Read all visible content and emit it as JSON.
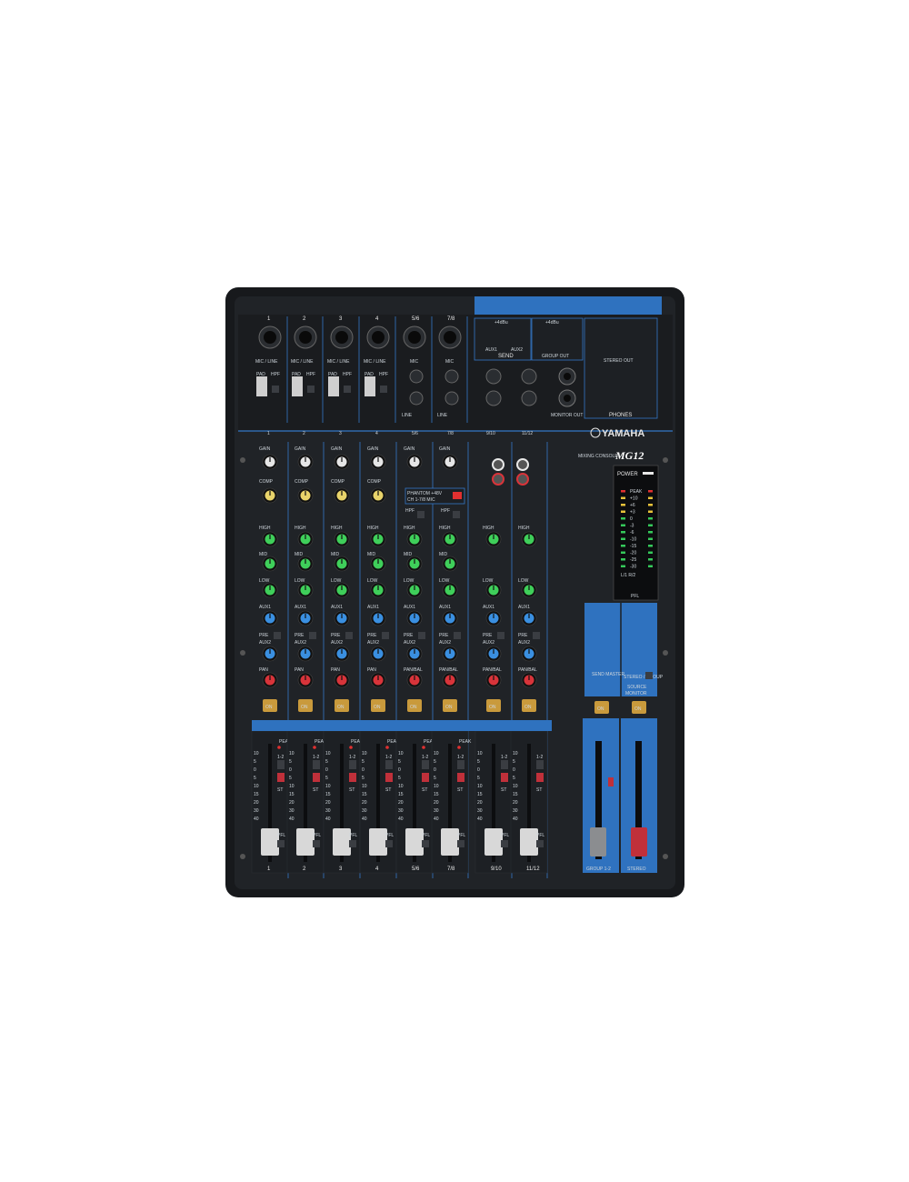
{
  "brand": "YAMAHA",
  "model_caption": "MIXING CONSOLE",
  "model": "MG12",
  "power_label": "POWER",
  "channels": [
    "1",
    "2",
    "3",
    "4",
    "5/6",
    "7/8",
    "9/10",
    "11/12"
  ],
  "mic_line_label": "MIC / LINE",
  "mic_label": "MIC",
  "pad_label": "PAD",
  "hpf_label": "HPF",
  "hpf_freq": "80Hz",
  "line_label": "LINE",
  "unbal_label": "UNBAL",
  "mono_label": "L/MONO",
  "send_label": "SEND",
  "aux1_label": "AUX1",
  "aux2_label": "AUX2",
  "group_out_label": "GROUP OUT",
  "stereo_out_label": "STEREO OUT",
  "phones_label": "PHONES",
  "monitor_out_label": "MONITOR OUT",
  "level_label": "+4dBu",
  "gain_label": "GAIN",
  "comp_label": "COMP",
  "high_label": "HIGH",
  "mid_label": "MID",
  "low_label": "LOW",
  "aux1_knob": "AUX1",
  "aux2_knob": "AUX2",
  "pre_label": "PRE",
  "pan_label": "PAN",
  "pan_bal_label": "PAN/BAL",
  "on_label": "ON",
  "peak_label": "PEAK",
  "pfl_label": "PFL",
  "st_label": "ST",
  "group_assign_label": "1-2",
  "phantom_label": "PHANTOM +48V",
  "phantom_sub": "CH 1-7/8 MIC",
  "hpf_mic_label": "HPF 80Hz (MIC)",
  "meter_scale": [
    "PEAK",
    "+10",
    "+6",
    "+3",
    "0",
    "-3",
    "-6",
    "-10",
    "-15",
    "-20",
    "-25",
    "-30"
  ],
  "meter_lr": "L/1   R/2",
  "pfl_meter": "PFL",
  "send_master_label": "SEND MASTER",
  "source_label": "SOURCE",
  "monitor_label": "MONITOR",
  "stereo_group_label": "STEREO / GROUP",
  "group12_label": "GROUP 1-2",
  "stereo_label": "STEREO",
  "fader_scale": [
    "10",
    "5",
    "0",
    "5",
    "10",
    "15",
    "20",
    "30",
    "40"
  ],
  "colors": {
    "body": "#1b1d20",
    "panel": "#202327",
    "blue": "#3478c8",
    "knob_green": "#3fcf5a",
    "knob_blue": "#3a8fe0",
    "knob_red": "#d8343a",
    "knob_yellow": "#e8d36a",
    "on_button": "#c99a3c"
  }
}
